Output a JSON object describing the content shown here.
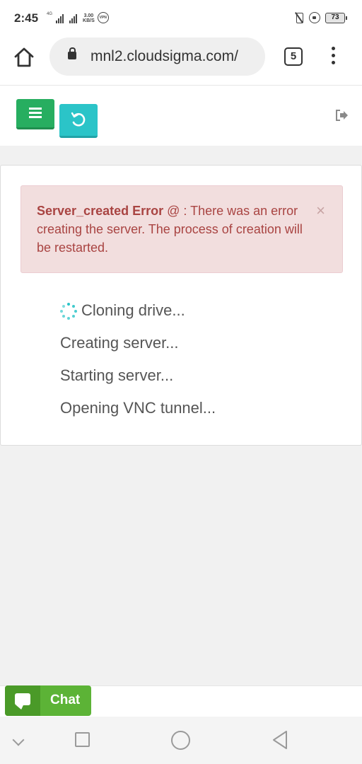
{
  "status_bar": {
    "time": "2:45",
    "network_tag": "4G",
    "speed_value": "3.00",
    "speed_unit": "KB/S",
    "vpn_label": "VPN",
    "battery": "73"
  },
  "browser": {
    "url": "mnl2.cloudsigma.com/",
    "tab_count": "5"
  },
  "alert": {
    "title": "Server_created Error",
    "message": " @ : There was an error creating the server. The process of creation will be restarted.",
    "close": "×"
  },
  "steps": [
    {
      "label": "Cloning drive...",
      "active": true
    },
    {
      "label": "Creating server...",
      "active": false
    },
    {
      "label": "Starting server...",
      "active": false
    },
    {
      "label": "Opening VNC tunnel...",
      "active": false
    }
  ],
  "chat": {
    "label": "Chat"
  },
  "colors": {
    "menu_button": "#27ae60",
    "refresh_button": "#2bc4c8",
    "alert_bg": "#f2dede",
    "alert_text": "#a94442",
    "chat_green": "#5cb336"
  },
  "icons": [
    "home-icon",
    "lock-icon",
    "kebab-menu-icon",
    "hamburger-icon",
    "refresh-icon",
    "logout-icon",
    "spinner-icon",
    "chat-bubble-icon"
  ]
}
